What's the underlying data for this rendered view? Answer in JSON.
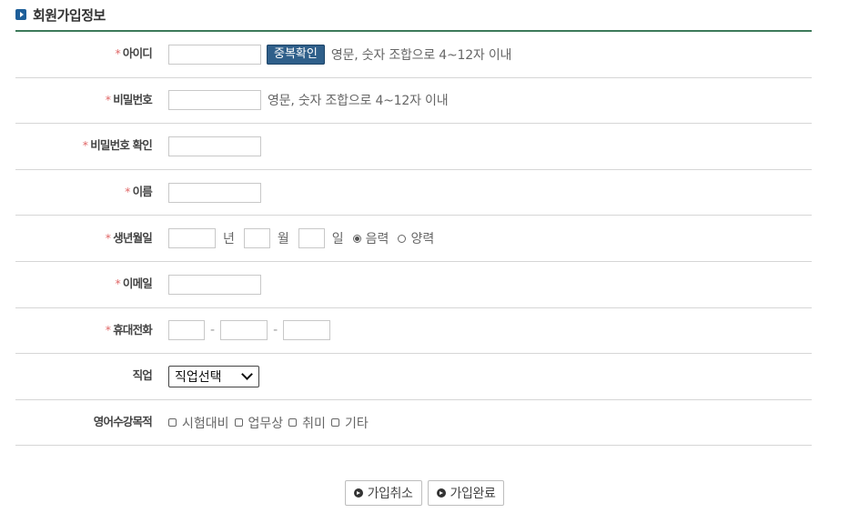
{
  "section": {
    "title": "회원가입정보"
  },
  "fields": {
    "id": {
      "required": "*",
      "label": "아이디",
      "dup_button": "중복확인",
      "hint": "영문, 숫자 조합으로 4~12자 이내"
    },
    "password": {
      "required": "*",
      "label": "비밀번호",
      "hint": "영문, 숫자 조합으로 4~12자 이내"
    },
    "password_confirm": {
      "required": "*",
      "label": "비밀번호 확인"
    },
    "name": {
      "required": "*",
      "label": "이름"
    },
    "birth": {
      "required": "*",
      "label": "생년월일",
      "year_unit": "년",
      "month_unit": "월",
      "day_unit": "일",
      "calendar_options": [
        {
          "label": "음력",
          "selected": true
        },
        {
          "label": "양력",
          "selected": false
        }
      ]
    },
    "email": {
      "required": "*",
      "label": "이메일"
    },
    "phone": {
      "required": "*",
      "label": "휴대전화",
      "separator": "-"
    },
    "job": {
      "label": "직업",
      "selected": "직업선택"
    },
    "purpose": {
      "label": "영어수강목적",
      "options": [
        "시험대비",
        "업무상",
        "취미",
        "기타"
      ]
    }
  },
  "actions": {
    "cancel": "가입취소",
    "submit": "가입완료"
  },
  "colors": {
    "accent": "#2f5f8a",
    "title_line": "#3d7a5a",
    "required": "#e06666"
  },
  "icons": {
    "title": "play-square-icon",
    "button": "play-circle-icon"
  }
}
